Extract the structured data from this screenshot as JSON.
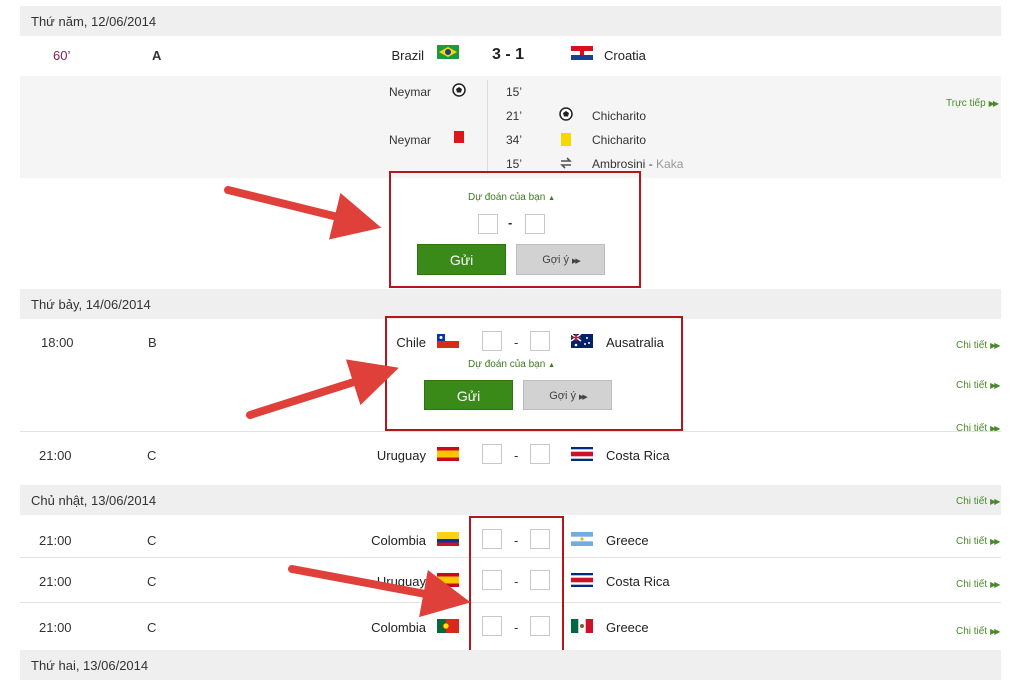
{
  "days": [
    {
      "label": "Thứ năm, 12/06/2014"
    },
    {
      "label": "Thứ bảy, 14/06/2014"
    },
    {
      "label": "Chủ nhật, 13/06/2014"
    },
    {
      "label": "Thứ hai, 13/06/2014"
    }
  ],
  "live_match": {
    "minute": "60’",
    "group": "A",
    "home": "Brazil",
    "away": "Croatia",
    "score": "3  -  1",
    "live_link": "Trực tiếp",
    "events_home": [
      {
        "player": "Neymar",
        "icon": "ball-icon"
      },
      {
        "player": "Neymar",
        "icon": "red-card-icon"
      }
    ],
    "minutes": [
      "15’",
      "21’",
      "34’",
      "15’"
    ],
    "events_away": [
      {
        "player": "Chicharito",
        "icon": "ball-icon"
      },
      {
        "player": "Chicharito",
        "icon": "yellow-card-icon"
      },
      {
        "player": "Ambrosini",
        "sep": " - ",
        "player_out": "Kaka",
        "icon": "substitution-icon"
      }
    ]
  },
  "prediction": {
    "label": "Dự đoán của bạn",
    "send": "Gửi",
    "hint": "Gợi ý",
    "dash": "-"
  },
  "matches": [
    {
      "time": "18:00",
      "group": "B",
      "home": "Chile",
      "away": "Ausatralia",
      "dash": "-"
    },
    {
      "time": "21:00",
      "group": "C",
      "home": "Uruguay",
      "away": "Costa Rica",
      "dash": "-"
    },
    {
      "time": "21:00",
      "group": "C",
      "home": "Colombia",
      "away": "Greece",
      "dash": "-"
    },
    {
      "time": "21:00",
      "group": "C",
      "home": "Uruguay",
      "away": "Costa Rica",
      "dash": "-"
    },
    {
      "time": "21:00",
      "group": "C",
      "home": "Colombia",
      "away": "Greece",
      "dash": "-"
    }
  ],
  "detail_link": "Chi tiết",
  "colors": {
    "accent_green": "#3a8a1a",
    "annotation_red": "#b3161b",
    "arrow_red": "#e0403a"
  }
}
